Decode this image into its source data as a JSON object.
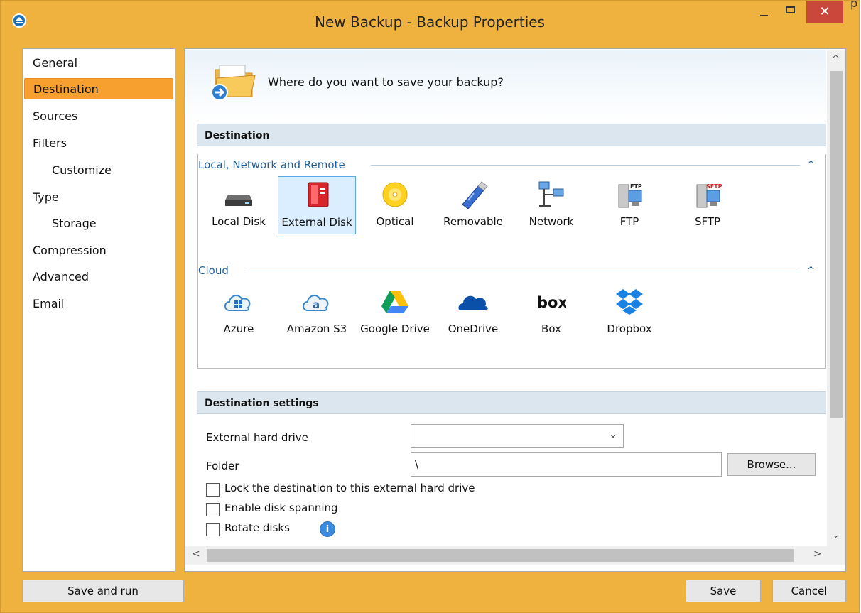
{
  "window": {
    "title": "New Backup - Backup Properties",
    "close_glyph": "✕",
    "edge_char": "p"
  },
  "sidebar": {
    "items": [
      {
        "label": "General",
        "indent": false,
        "selected": false
      },
      {
        "label": "Destination",
        "indent": false,
        "selected": true
      },
      {
        "label": "Sources",
        "indent": false,
        "selected": false
      },
      {
        "label": "Filters",
        "indent": false,
        "selected": false
      },
      {
        "label": "Customize",
        "indent": true,
        "selected": false
      },
      {
        "label": "Type",
        "indent": false,
        "selected": false
      },
      {
        "label": "Storage",
        "indent": true,
        "selected": false
      },
      {
        "label": "Compression",
        "indent": false,
        "selected": false
      },
      {
        "label": "Advanced",
        "indent": false,
        "selected": false
      },
      {
        "label": "Email",
        "indent": false,
        "selected": false
      }
    ]
  },
  "header": {
    "question": "Where do you want to save your backup?",
    "icon": "folder-arrow-icon"
  },
  "destination": {
    "section_title": "Destination",
    "local_group_title": "Local, Network and Remote",
    "cloud_group_title": "Cloud",
    "collapse_glyph": "^",
    "local_items": [
      {
        "label": "Local Disk",
        "icon": "local-disk-icon",
        "selected": false
      },
      {
        "label": "External Disk",
        "icon": "external-disk-icon",
        "selected": true
      },
      {
        "label": "Optical",
        "icon": "optical-disc-icon",
        "selected": false
      },
      {
        "label": "Removable",
        "icon": "usb-drive-icon",
        "selected": false
      },
      {
        "label": "Network",
        "icon": "network-icon",
        "selected": false
      },
      {
        "label": "FTP",
        "icon": "ftp-server-icon",
        "selected": false,
        "badge": "FTP"
      },
      {
        "label": "SFTP",
        "icon": "sftp-server-icon",
        "selected": false,
        "badge": "SFTP"
      }
    ],
    "cloud_items": [
      {
        "label": "Azure",
        "icon": "azure-cloud-icon"
      },
      {
        "label": "Amazon S3",
        "icon": "amazon-s3-icon",
        "glyph": "a"
      },
      {
        "label": "Google Drive",
        "icon": "google-drive-icon"
      },
      {
        "label": "OneDrive",
        "icon": "onedrive-icon"
      },
      {
        "label": "Box",
        "icon": "box-logo-icon",
        "glyph": "box"
      },
      {
        "label": "Dropbox",
        "icon": "dropbox-icon"
      }
    ]
  },
  "settings": {
    "section_title": "Destination settings",
    "external_drive_label": "External hard drive",
    "external_drive_value": "",
    "chevron": "⌄",
    "folder_label": "Folder",
    "folder_value": "\\",
    "browse_label": "Browse...",
    "checkboxes": [
      {
        "label": "Lock the destination to this external hard drive",
        "checked": false
      },
      {
        "label": "Enable disk spanning",
        "checked": false
      },
      {
        "label": "Rotate disks",
        "checked": false,
        "info": true
      }
    ],
    "info_glyph": "i"
  },
  "scrollbars": {
    "up": "^",
    "down": "⌄",
    "left": "<",
    "right": ">"
  },
  "footer": {
    "save_and_run_label": "Save and run",
    "save_label": "Save",
    "cancel_label": "Cancel"
  },
  "colors": {
    "frame": "#f0b23e",
    "selected_nav": "#f7a030",
    "section_bar": "#dce6ef",
    "group_title": "#1f5f99",
    "selected_tile": "#dbeeff",
    "close_button": "#c9483b"
  }
}
